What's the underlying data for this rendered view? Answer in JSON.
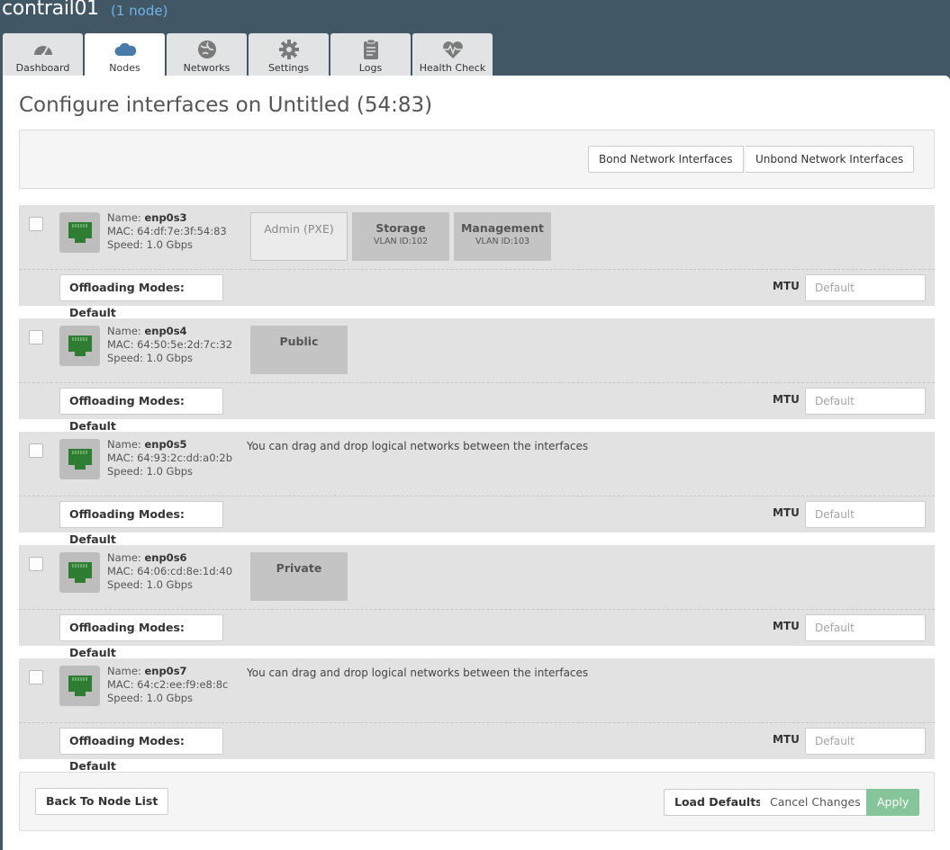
{
  "header": {
    "env_name": "contrail01",
    "node_count": "(1 node)"
  },
  "tabs": [
    {
      "label": "Dashboard",
      "icon": "dashboard-icon"
    },
    {
      "label": "Nodes",
      "icon": "cloud-icon",
      "active": true
    },
    {
      "label": "Networks",
      "icon": "globe-icon"
    },
    {
      "label": "Settings",
      "icon": "gear-icon"
    },
    {
      "label": "Logs",
      "icon": "clipboard-icon"
    },
    {
      "label": "Health Check",
      "icon": "heart-pulse-icon"
    }
  ],
  "page": {
    "title": "Configure interfaces on Untitled (54:83)"
  },
  "toolbar": {
    "bond_label": "Bond Network Interfaces",
    "unbond_label": "Unbond Network Interfaces"
  },
  "labels": {
    "name": "Name:",
    "mac": "MAC:",
    "speed": "Speed:",
    "offloading": "Offloading Modes: Default",
    "mtu": "MTU",
    "mtu_placeholder": "Default"
  },
  "interfaces": [
    {
      "name": "enp0s3",
      "mac": "64:df:7e:3f:54:83",
      "speed": "1.0 Gbps",
      "networks": [
        {
          "name": "Admin (PXE)",
          "vlan": ""
        },
        {
          "name": "Storage",
          "vlan": "VLAN ID:102"
        },
        {
          "name": "Management",
          "vlan": "VLAN ID:103"
        }
      ],
      "hint": ""
    },
    {
      "name": "enp0s4",
      "mac": "64:50:5e:2d:7c:32",
      "speed": "1.0 Gbps",
      "networks": [
        {
          "name": "Public",
          "vlan": ""
        }
      ],
      "hint": ""
    },
    {
      "name": "enp0s5",
      "mac": "64:93:2c:dd:a0:2b",
      "speed": "1.0 Gbps",
      "networks": [],
      "hint": "You can drag and drop logical networks between the interfaces"
    },
    {
      "name": "enp0s6",
      "mac": "64:06:cd:8e:1d:40",
      "speed": "1.0 Gbps",
      "networks": [
        {
          "name": "Private",
          "vlan": ""
        }
      ],
      "hint": ""
    },
    {
      "name": "enp0s7",
      "mac": "64:c2:ee:f9:e8:8c",
      "speed": "1.0 Gbps",
      "networks": [],
      "hint": "You can drag and drop logical networks between the interfaces"
    }
  ],
  "footer": {
    "back_label": "Back To Node List",
    "load_label": "Load Defaults",
    "cancel_label": "Cancel Changes",
    "apply_label": "Apply"
  },
  "colors": {
    "header_bg": "#415766",
    "port_green": "#2e7d32",
    "apply_bg": "#86c49a",
    "link_blue": "#6fb3e6"
  }
}
